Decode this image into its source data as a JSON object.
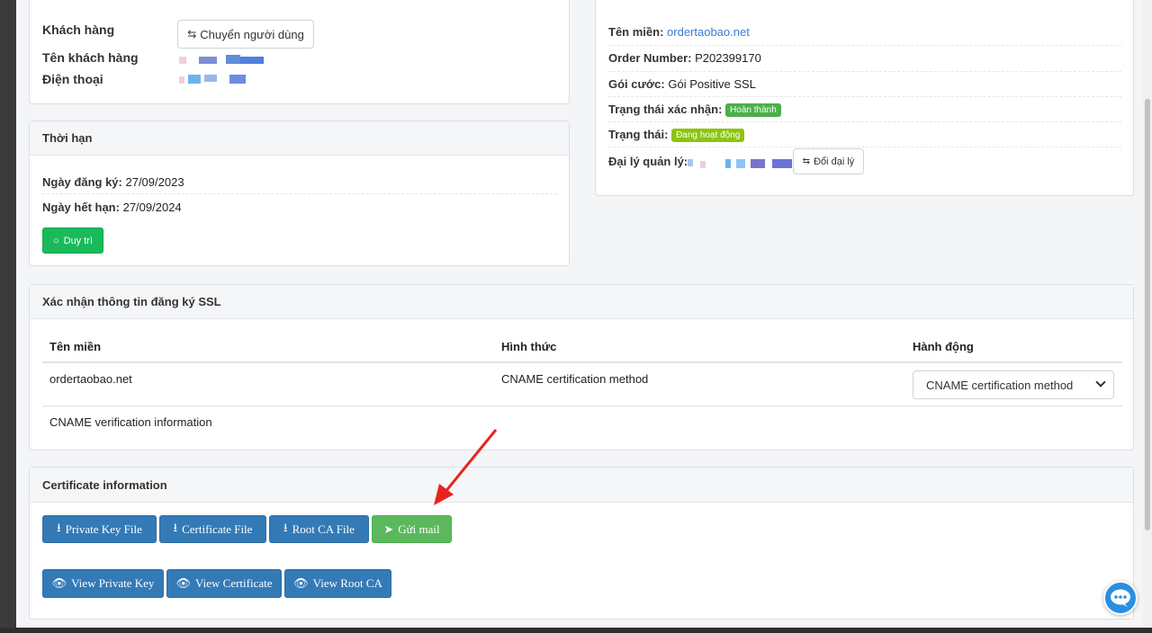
{
  "customer": {
    "label_customer": "Khách hàng",
    "label_name": "Tên khách hàng",
    "label_phone": "Điện thoại",
    "switch_user_button": "Chuyển người dùng"
  },
  "term": {
    "title": "Thời hạn",
    "registered_label": "Ngày đăng ký:",
    "registered_value": "27/09/2023",
    "expiry_label": "Ngày hết hạn:",
    "expiry_value": "27/09/2024",
    "maintain_button": "Duy trì"
  },
  "order": {
    "domain_label": "Tên miền:",
    "domain_value": "ordertaobao.net",
    "order_number_label": "Order Number:",
    "order_number_value": "P202399170",
    "package_label": "Gói cước:",
    "package_value": "Gói Positive SSL",
    "verify_status_label": "Trạng thái xác nhận:",
    "verify_status_value": "Hoàn thành",
    "status_label": "Trạng thái:",
    "status_value": "Đang hoạt động",
    "agent_label": "Đại lý quản lý:",
    "change_agent_button": "Đổi đại lý"
  },
  "ssl_confirm": {
    "title": "Xác nhận thông tin đăng ký SSL",
    "columns": [
      "Tên miền",
      "Hình thức",
      "Hành động"
    ],
    "row": {
      "domain": "ordertaobao.net",
      "method": "CNAME certification method",
      "action_selected": "CNAME certification method"
    },
    "cname_info": "CNAME verification information"
  },
  "certificate": {
    "title": "Certificate information",
    "buttons_row1": [
      "Private Key File",
      "Certificate File",
      "Root CA File",
      "Gửi mail"
    ],
    "buttons_row2": [
      "View Private Key",
      "View Certificate",
      "View Root CA"
    ]
  },
  "colors": {
    "primary": "#337ab7",
    "success": "#5cb85c",
    "badge_done": "#4cae4c",
    "badge_active": "#8cc40f",
    "annotation_arrow": "#e8231f"
  },
  "icons": {
    "swap": "swap-icon",
    "refresh": "refresh-icon",
    "download": "download-icon",
    "send": "paper-plane-icon",
    "eye": "eye-icon",
    "chat": "chat-bubble-icon",
    "dropdown": "chevron-down-icon"
  }
}
